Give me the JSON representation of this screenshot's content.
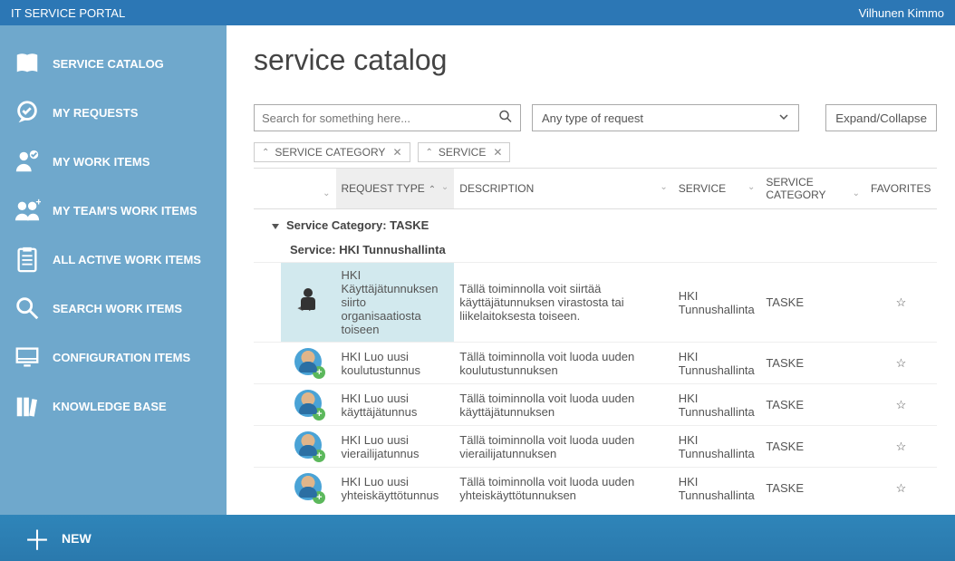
{
  "header": {
    "app_title": "IT SERVICE PORTAL",
    "user_name": "Vilhunen Kimmo"
  },
  "sidebar": {
    "items": [
      {
        "label": "SERVICE CATALOG",
        "icon": "book-icon"
      },
      {
        "label": "MY REQUESTS",
        "icon": "check-bubble-icon"
      },
      {
        "label": "MY WORK ITEMS",
        "icon": "person-check-icon"
      },
      {
        "label": "MY TEAM'S WORK ITEMS",
        "icon": "team-plus-icon"
      },
      {
        "label": "ALL ACTIVE WORK ITEMS",
        "icon": "clipboard-list-icon"
      },
      {
        "label": "SEARCH WORK ITEMS",
        "icon": "magnifier-icon"
      },
      {
        "label": "CONFIGURATION ITEMS",
        "icon": "monitor-icon"
      },
      {
        "label": "KNOWLEDGE BASE",
        "icon": "books-icon"
      }
    ]
  },
  "page": {
    "title": "service catalog",
    "search_placeholder": "Search for something here...",
    "type_filter_label": "Any type of request",
    "expand_collapse_label": "Expand/Collapse"
  },
  "chips": [
    {
      "label": "SERVICE CATEGORY"
    },
    {
      "label": "SERVICE"
    }
  ],
  "columns": {
    "request_type": "REQUEST TYPE",
    "description": "DESCRIPTION",
    "service": "SERVICE",
    "service_category": "SERVICE CATEGORY",
    "favorites": "FAVORITES"
  },
  "group": {
    "category_label": "Service Category:",
    "category_value": "TASKE",
    "service_label": "Service:",
    "service_value": "HKI Tunnushallinta"
  },
  "rows": [
    {
      "icon": "transfer",
      "request_type": "HKI Käyttäjätunnuksen siirto organisaatiosta toiseen",
      "description": "Tällä toiminnolla voit siirtää käyttäjätunnuksen virastosta tai liikelaitoksesta toiseen.",
      "service": "HKI Tunnushallinta",
      "category": "TASKE",
      "selected": true
    },
    {
      "icon": "person-plus",
      "request_type": "HKI Luo uusi koulutustunnus",
      "description": "Tällä toiminnolla voit luoda uuden koulutustunnuksen",
      "service": "HKI Tunnushallinta",
      "category": "TASKE",
      "selected": false
    },
    {
      "icon": "person-plus",
      "request_type": "HKI Luo uusi käyttäjätunnus",
      "description": "Tällä toiminnolla voit luoda uuden käyttäjätunnuksen",
      "service": "HKI Tunnushallinta",
      "category": "TASKE",
      "selected": false
    },
    {
      "icon": "person-plus",
      "request_type": "HKI Luo uusi vierailijatunnus",
      "description": "Tällä toiminnolla voit luoda uuden vierailijatunnuksen",
      "service": "HKI Tunnushallinta",
      "category": "TASKE",
      "selected": false
    },
    {
      "icon": "person-plus",
      "request_type": "HKI Luo uusi yhteiskäyttötunnus",
      "description": "Tällä toiminnolla voit luoda uuden yhteiskäyttötunnuksen",
      "service": "HKI Tunnushallinta",
      "category": "TASKE",
      "selected": false
    }
  ],
  "footer": {
    "new_label": "NEW"
  }
}
